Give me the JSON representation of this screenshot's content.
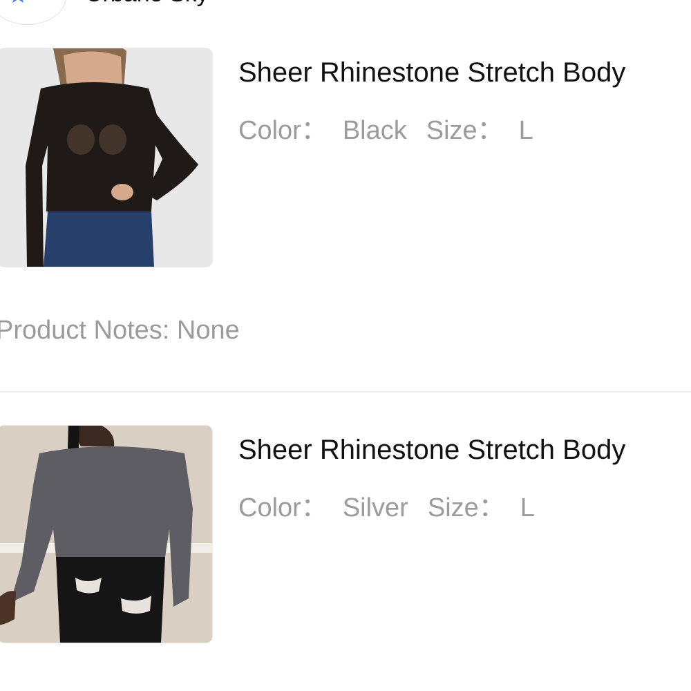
{
  "store": {
    "name": "Urbane Sky",
    "logo_icon": "compass-star-logo-icon",
    "badge_icon": "verified-star-badge-icon",
    "badge_color": "#4a7be0"
  },
  "products": [
    {
      "title": "Sheer Rhinestone Stretch Body",
      "color_label": "Color：",
      "color_value": "Black",
      "size_label": "Size：",
      "size_value": "L",
      "image_alt": "Black sheer rhinestone bodysuit on model with jeans"
    },
    {
      "title": "Sheer Rhinestone Stretch Body",
      "color_label": "Color：",
      "color_value": "Silver",
      "size_label": "Size：",
      "size_value": "L",
      "image_alt": "Silver sheer rhinestone bodysuit on model with black ripped jeans"
    }
  ],
  "notes": {
    "label": "Product Notes:",
    "value": "None"
  }
}
